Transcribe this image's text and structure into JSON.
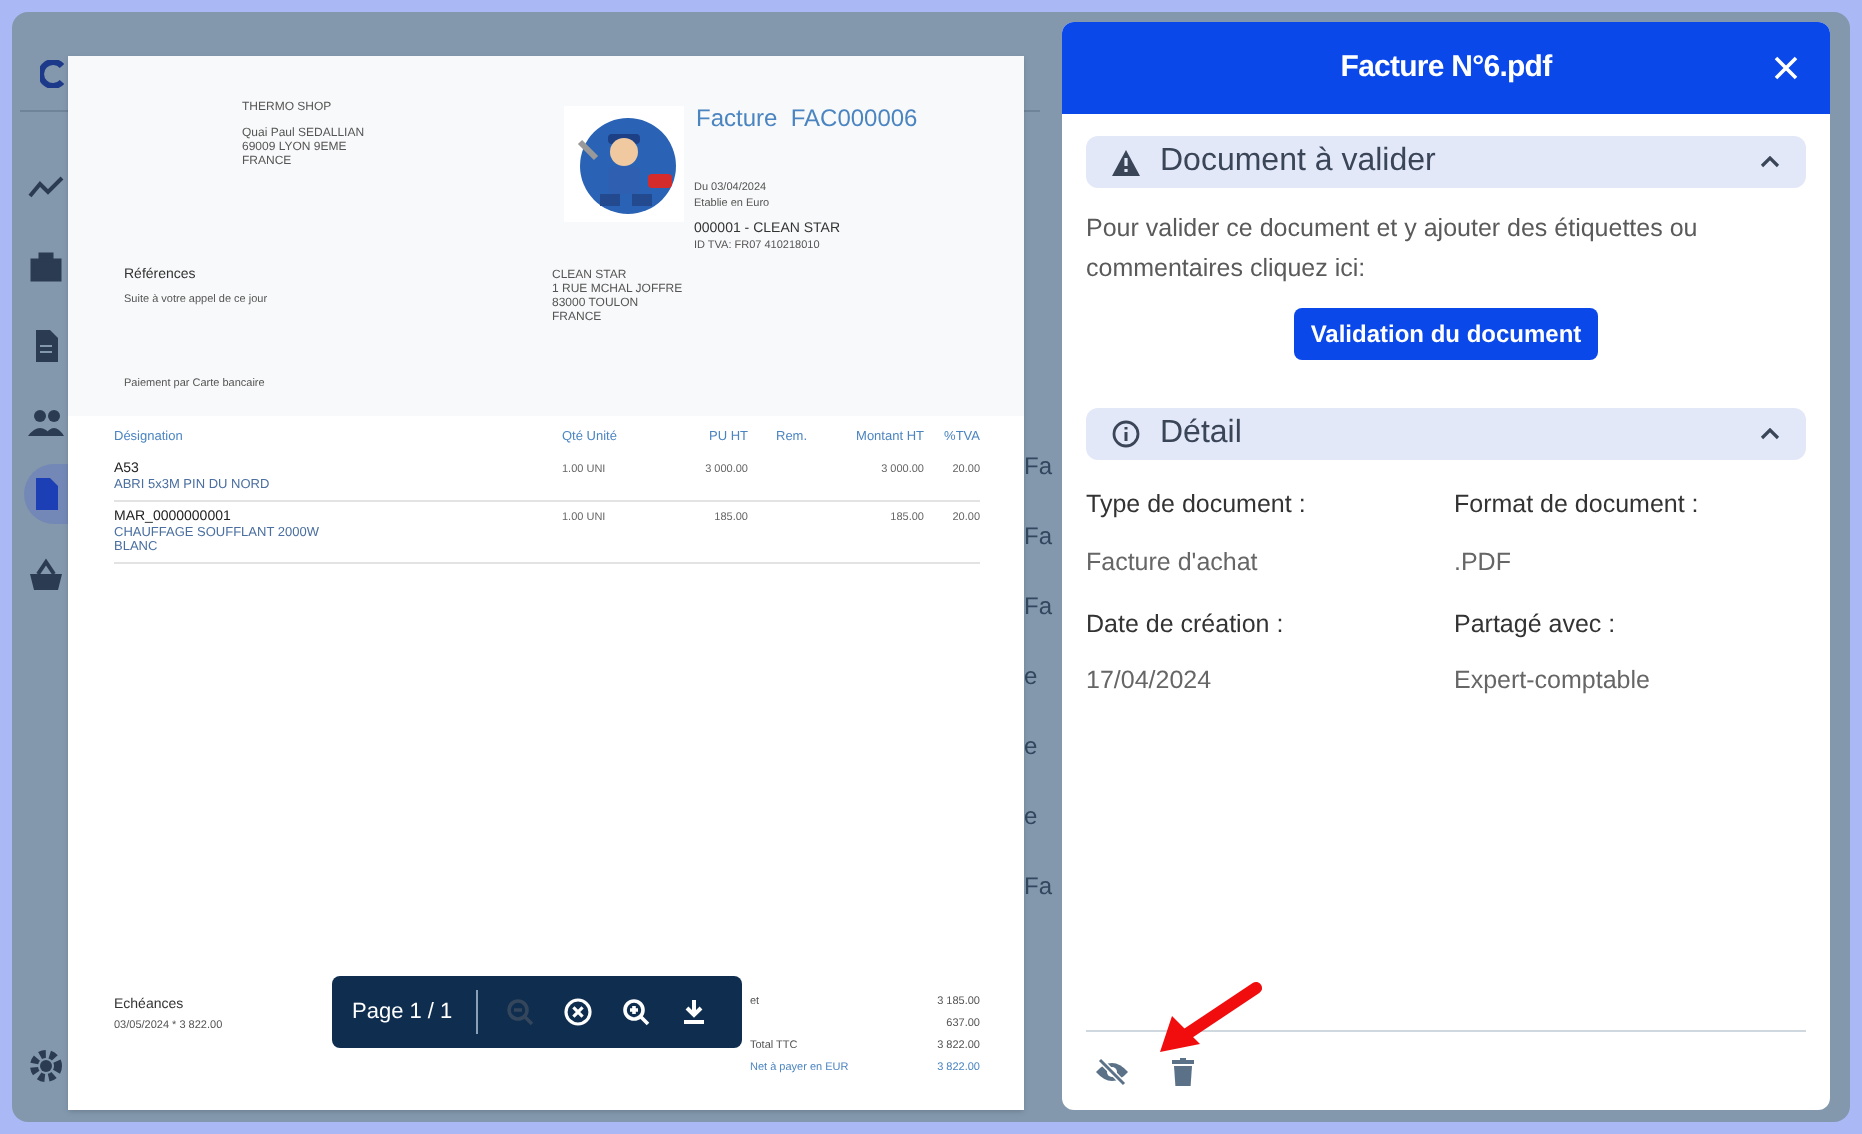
{
  "background_app": {
    "sidebar": [
      {
        "kind": "chart",
        "selected": false
      },
      {
        "kind": "bag",
        "selected": false
      },
      {
        "kind": "document",
        "selected": false
      },
      {
        "kind": "people",
        "selected": false
      },
      {
        "kind": "file",
        "selected": true
      },
      {
        "kind": "basket",
        "selected": false
      },
      {
        "kind": "gear",
        "selected": false
      }
    ],
    "strip_labels": [
      "Fa",
      "Fa",
      "Fa",
      "e",
      "e",
      "e",
      "Fa"
    ]
  },
  "invoice": {
    "seller": [
      "THERMO SHOP",
      "Quai Paul SEDALLIAN",
      "69009 LYON 9EME",
      "FRANCE"
    ],
    "title": "Facture  FAC000006",
    "meta": [
      "Du 03/04/2024",
      "Etablie en Euro"
    ],
    "client_code": "000001 - CLEAN STAR",
    "vat_id": "ID TVA: FR07 410218010",
    "references_title": "Références",
    "references_text": "Suite à votre appel de ce jour",
    "client_address": [
      "CLEAN STAR",
      "1 RUE MCHAL JOFFRE",
      "83000 TOULON",
      "FRANCE"
    ],
    "payment": "Paiement par Carte bancaire",
    "columns": [
      "Désignation",
      "Qté Unité",
      "PU HT",
      "Rem.",
      "Montant HT",
      "%TVA"
    ],
    "rows": [
      {
        "code": "A53",
        "description": [
          "ABRI 5x3M PIN DU NORD"
        ],
        "qty": "1.00 UNI",
        "unit_price": "3 000.00",
        "amount": "3 000.00",
        "vat": "20.00"
      },
      {
        "code": "MAR_0000000001",
        "description": [
          "CHAUFFAGE SOUFFLANT 2000W",
          "BLANC"
        ],
        "qty": "1.00 UNI",
        "unit_price": "185.00",
        "amount": "185.00",
        "vat": "20.00"
      }
    ],
    "schedule_title": "Echéances",
    "schedule_text": "03/05/2024 * 3 822.00",
    "totals": [
      {
        "label": "et",
        "value": "3 185.00",
        "kind": "plain"
      },
      {
        "value": "637.00",
        "kind": "plain"
      },
      {
        "label": "Total TTC",
        "value": "3 822.00",
        "kind": "plain"
      },
      {
        "label": "Net à payer en EUR",
        "value": "3 822.00",
        "kind": "net"
      }
    ]
  },
  "viewer_toolbar": {
    "page_label": "Page 1 / 1",
    "buttons": [
      {
        "kind": "zoom_out",
        "disabled": true
      },
      {
        "kind": "reset",
        "disabled": false
      },
      {
        "kind": "zoom_in",
        "disabled": false
      },
      {
        "kind": "download",
        "disabled": false
      }
    ]
  },
  "panel": {
    "title": "Facture N°6.pdf",
    "sections": [
      {
        "kind": "validation",
        "title": "Document à valider",
        "expanded": true,
        "text": "Pour valider ce document et y ajouter des étiquettes ou commentaires cliquez ici:",
        "button": "Validation du document"
      },
      {
        "kind": "details",
        "title": "Détail",
        "expanded": true,
        "fields": [
          {
            "label": "Type de document :",
            "value": "Facture d'achat"
          },
          {
            "label": "Format de document :",
            "value": ".PDF"
          },
          {
            "label": "Date de création :",
            "value": "17/04/2024"
          },
          {
            "label": "Partagé avec :",
            "value": "Expert-comptable"
          }
        ]
      }
    ],
    "footer_actions": [
      {
        "kind": "hide"
      },
      {
        "kind": "delete"
      }
    ]
  }
}
